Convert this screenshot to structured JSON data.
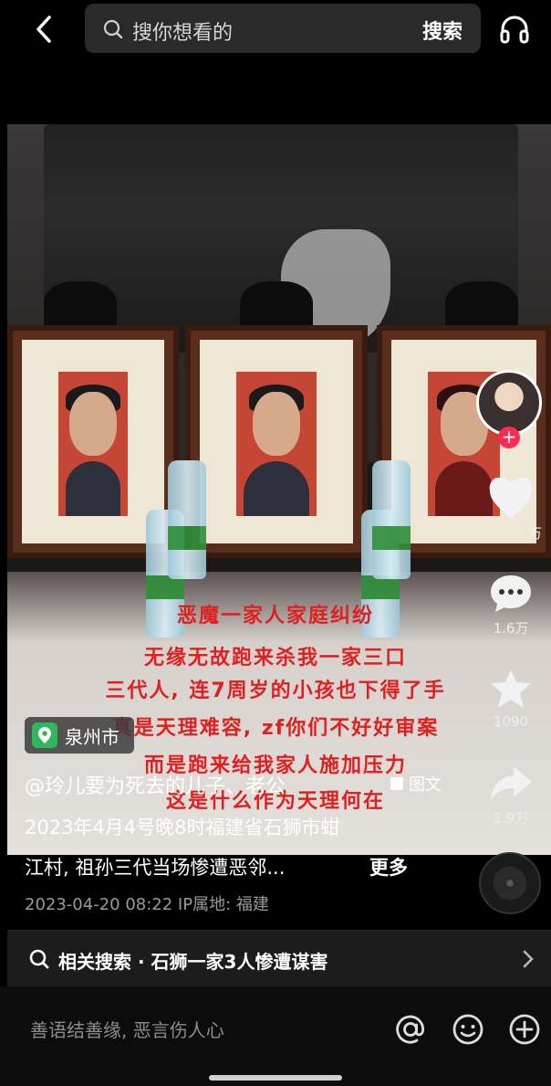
{
  "header": {
    "search_placeholder": "搜你想看的",
    "search_button": "搜索"
  },
  "overlay_lines": [
    "恶魔一家人家庭纠纷",
    "无缘无故跑来杀我一家三口",
    "三代人, 连7周岁的小孩也下得了手",
    "真是天理难容, zf你们不好好审案",
    "而是跑来给我家人施加压力",
    "这是什么作为天理何在"
  ],
  "side": {
    "like_count": "万",
    "comment_count": "1.6万",
    "favorite_count": "1090",
    "share_count": "1.9万"
  },
  "location": "泉州市",
  "author": "@玲儿要为死去的儿子、老公",
  "post_type": "图文",
  "description_line1": "2023年4月4号晚8时福建省石狮市蚶",
  "description_line2": "江村, 祖孙三代当场惨遭恶邻...",
  "more_label": "更多",
  "meta": "2023-04-20 08:22  IP属地: 福建",
  "related_search": "相关搜索 · 石狮一家3人惨遭谋害",
  "comment_placeholder": "善语结善缘, 恶言伤人心"
}
